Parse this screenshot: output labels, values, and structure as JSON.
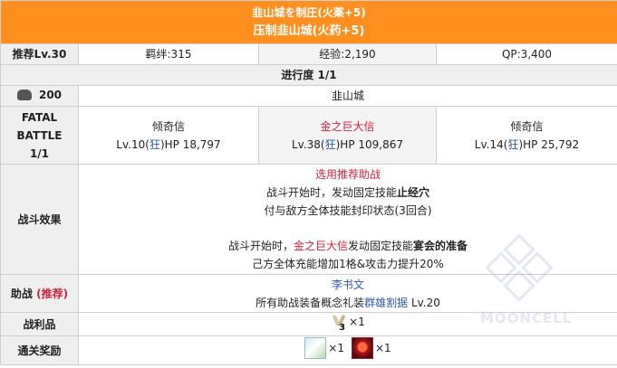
{
  "header": {
    "title_line1": "韭山城を制圧(火薬+5)",
    "title_line2": "压制韭山城(火药+5)"
  },
  "info_row": {
    "label": "推荐Lv.30",
    "bond": "羁绊:315",
    "exp": "经验:2,190",
    "qp": "QP:3,400"
  },
  "progress": "进行度 1/1",
  "ap_row": {
    "ap_value": "200",
    "location": "韭山城"
  },
  "battle": {
    "label_line1": "FATAL",
    "label_line2": "BATTLE",
    "label_line3": "1/1",
    "enemies": [
      {
        "name": "倾奇信",
        "lv_prefix": "Lv.10(",
        "cls": "狂",
        "hp": ")HP 18,797",
        "name_color": "normal"
      },
      {
        "name": "金之巨大信",
        "lv_prefix": "Lv.38(",
        "cls": "狂",
        "hp": ")HP 109,867",
        "name_color": "red"
      },
      {
        "name": "倾奇信",
        "lv_prefix": "Lv.14(",
        "cls": "狂",
        "hp": ")HP 25,792",
        "name_color": "normal"
      }
    ]
  },
  "effect": {
    "label": "战斗效果",
    "support_note": "选用推荐助战",
    "line1_prefix": "战斗开始时，发动固定技能",
    "line1_bold": "止经穴",
    "line2": "付与敌方全体技能封印状态(3回合)",
    "line3_prefix": "战斗开始时，",
    "line3_red": "金之巨大信",
    "line3_mid": "发动固定技能",
    "line3_bold": "宴会的准备",
    "line4": "己方全体充能增加1格&攻击力提升20%"
  },
  "support": {
    "label": "助战",
    "label_red": "(推荐)",
    "servant": "李书文",
    "ce_prefix": "所有助战装备概念礼装",
    "ce_name": "群雄割据",
    "ce_lv": " Lv.20"
  },
  "drops": {
    "label": "战利品",
    "count": "×1",
    "icon_num": "3"
  },
  "rewards": {
    "label": "通关奖励",
    "items": [
      {
        "icon": "ce-card-icon",
        "count": "×1"
      },
      {
        "icon": "fire-card-icon",
        "count": "×1"
      }
    ]
  },
  "watermark": "MOONCELL",
  "colors": {
    "header_bg": "#ff8f1f",
    "label_bg": "#efefef",
    "red": "#d3213d",
    "blue": "#2a58b4"
  }
}
